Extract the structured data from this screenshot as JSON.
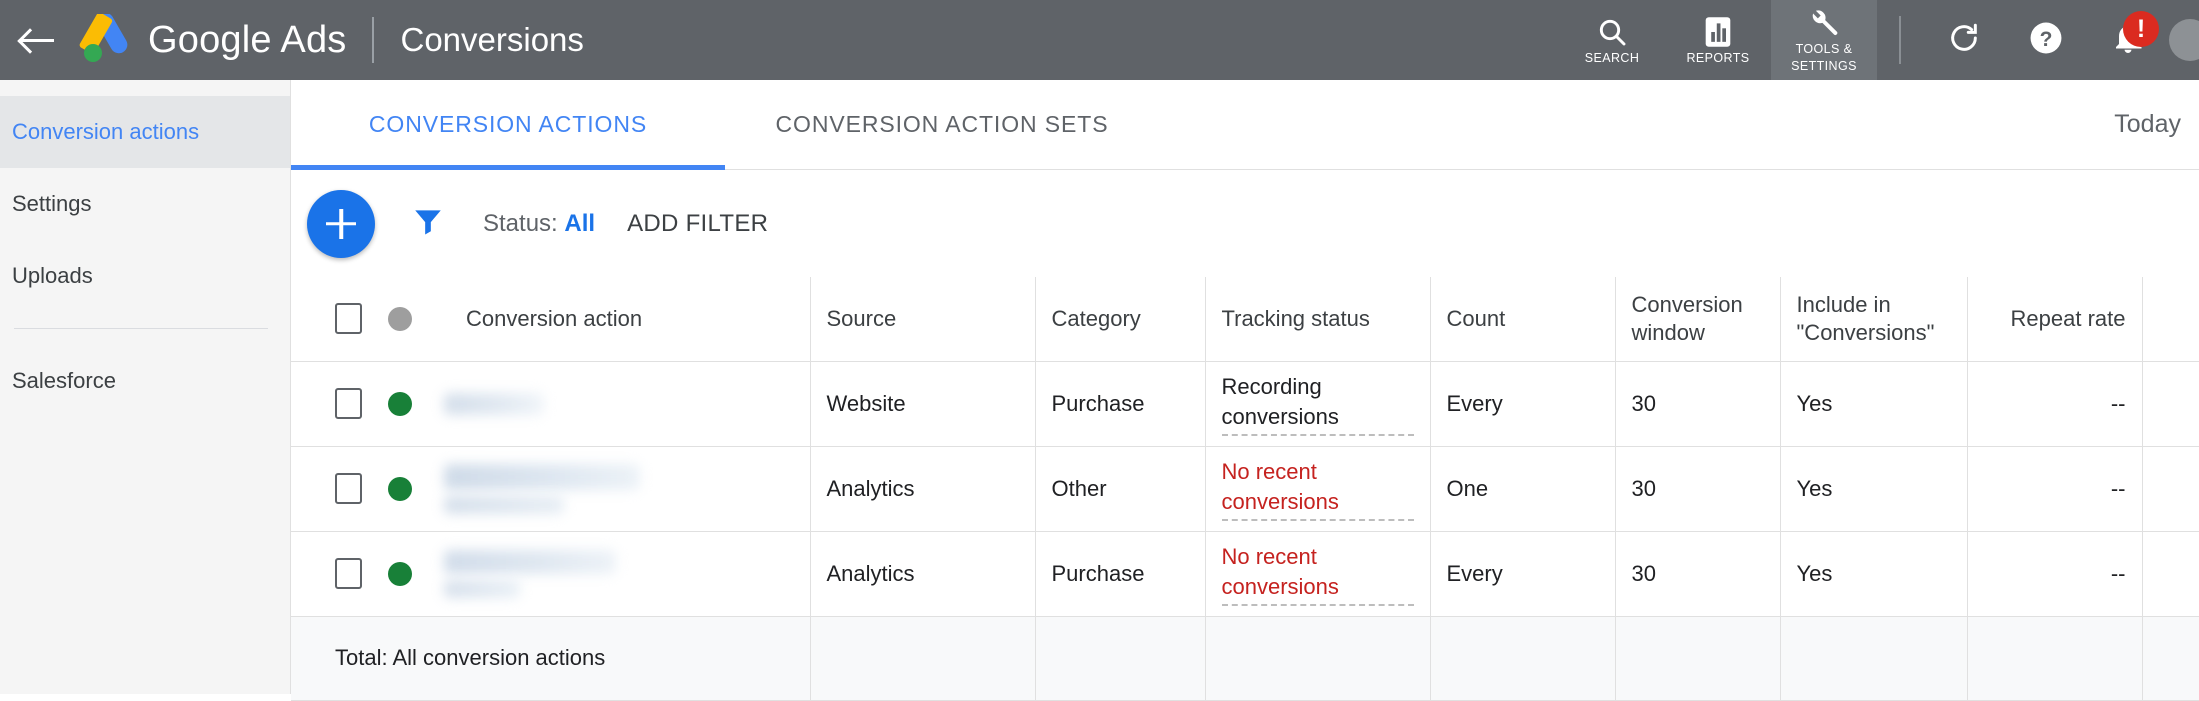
{
  "appbar": {
    "back_icon": "back-arrow-icon",
    "logo_icon": "google-ads-logo",
    "brand": "Google Ads",
    "page_title": "Conversions",
    "tools": [
      {
        "label": "SEARCH",
        "icon": "search-icon"
      },
      {
        "label": "REPORTS",
        "icon": "reports-bar-chart-icon"
      },
      {
        "label": "TOOLS & SETTINGS",
        "label_line1": "TOOLS &",
        "label_line2": "SETTINGS",
        "icon": "wrench-icon",
        "active": true
      }
    ],
    "actions": [
      {
        "name": "refresh-icon"
      },
      {
        "name": "help-icon"
      },
      {
        "name": "notifications-bell-icon",
        "badge": "!"
      }
    ],
    "bar_color": "#5f6368",
    "badge_color": "#db2b20"
  },
  "sidebar": {
    "items": [
      {
        "label": "Conversion actions",
        "selected": true
      },
      {
        "label": "Settings",
        "selected": false
      },
      {
        "label": "Uploads",
        "selected": false
      },
      {
        "label": "Salesforce",
        "selected": false
      }
    ],
    "selected_color": "#4285f4"
  },
  "tabs": {
    "items": [
      {
        "label": "CONVERSION ACTIONS",
        "active": true
      },
      {
        "label": "CONVERSION ACTION SETS",
        "active": false
      }
    ],
    "date_range": "Today",
    "accent": "#4285f4"
  },
  "toolbar": {
    "add_button_icon": "plus-icon",
    "filter_icon": "funnel-filter-icon",
    "status_label": "Status:",
    "status_value": "All",
    "add_filter_label": "ADD FILTER"
  },
  "table": {
    "columns": [
      "Conversion action",
      "Source",
      "Category",
      "Tracking status",
      "Count",
      "Conversion window",
      "Include in \"Conversions\"",
      "Repeat rate"
    ],
    "header_dot": "status-dot-header",
    "rows": [
      {
        "checked": false,
        "status_color": "#188038",
        "name": "",
        "source": "Website",
        "category": "Purchase",
        "tracking_status": "Recording conversions",
        "tracking_state": "ok",
        "count": "Every",
        "conversion_window": "30",
        "include_in_conversions": "Yes",
        "repeat_rate": "--"
      },
      {
        "checked": false,
        "status_color": "#188038",
        "name": "",
        "source": "Analytics",
        "category": "Other",
        "tracking_status": "No recent conversions",
        "tracking_state": "warn",
        "count": "One",
        "conversion_window": "30",
        "include_in_conversions": "Yes",
        "repeat_rate": "--"
      },
      {
        "checked": false,
        "status_color": "#188038",
        "name": "",
        "source": "Analytics",
        "category": "Purchase",
        "tracking_status": "No recent conversions",
        "tracking_state": "warn",
        "count": "Every",
        "conversion_window": "30",
        "include_in_conversions": "Yes",
        "repeat_rate": "--"
      }
    ],
    "total_label": "Total: All conversion actions",
    "warn_color": "#c5221f",
    "active_dot_color": "#188038"
  }
}
